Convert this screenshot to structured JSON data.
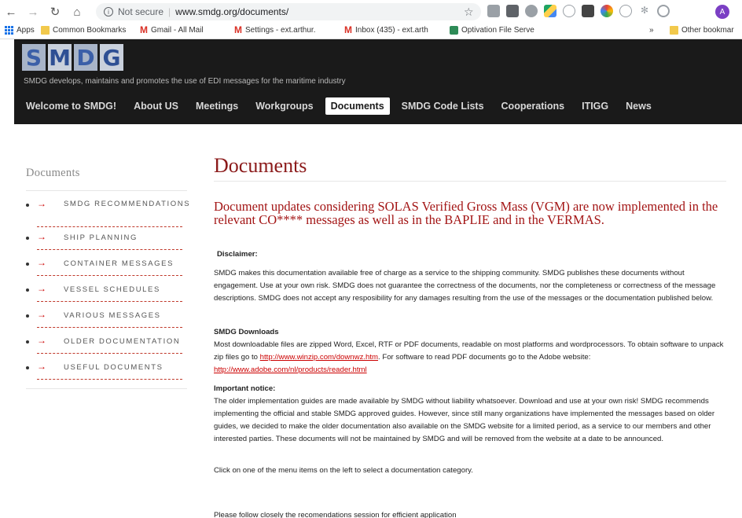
{
  "browser": {
    "not_secure": "Not secure",
    "url": "www.smdg.org/documents/",
    "avatar_letter": "A",
    "bookmarks": {
      "apps": "Apps",
      "common": "Common Bookmarks",
      "gmail": "Gmail - All Mail",
      "settings": "Settings - ext.arthur.",
      "inbox": "Inbox (435) - ext.arth",
      "optivation": "Optivation File Serve",
      "more": "»",
      "other": "Other bookmar"
    }
  },
  "header": {
    "logo_letters": [
      "S",
      "M",
      "D",
      "G"
    ],
    "tagline": "SMDG develops, maintains and promotes the use of EDI messages for the maritime industry",
    "nav": [
      "Welcome to SMDG!",
      "About US",
      "Meetings",
      "Workgroups",
      "Documents",
      "SMDG Code Lists",
      "Cooperations",
      "ITIGG",
      "News"
    ],
    "active_nav": "Documents"
  },
  "sidebar": {
    "title": "Documents",
    "items": [
      {
        "label": "SMDG RECOMMENDATIONS"
      },
      {
        "label": "SHIP PLANNING"
      },
      {
        "label": "CONTAINER MESSAGES"
      },
      {
        "label": "VESSEL SCHEDULES"
      },
      {
        "label": "VARIOUS MESSAGES"
      },
      {
        "label": "OLDER DOCUMENTATION"
      },
      {
        "label": "USEFUL DOCUMENTS"
      }
    ]
  },
  "main": {
    "title": "Documents",
    "headline": "Document updates considering SOLAS Verified Gross Mass (VGM) are now implemented in the relevant CO**** messages as well as in the BAPLIE and in the VERMAS.",
    "disclaimer_heading": "Disclaimer:",
    "disclaimer_text": "SMDG makes this documentation available free of charge as a service to the shipping community. SMDG publishes these documents without engagement. Use at your own risk. SMDG does not guarantee the correctness of the documents, nor the completeness or correctness of the message descriptions. SMDG does not accept any resposibility for any damages resulting from the use of the messages or the documentation published below.",
    "downloads_heading": "SMDG Downloads",
    "downloads_text_1": "Most downloadable files are zipped Word, Excel, RTF or PDF documents, readable on most platforms and wordprocessors. To obtain software to unpack zip files go to ",
    "downloads_link_1": "http://www.winzip.com/downwz.htm",
    "downloads_text_2": ". For software to read PDF documents go to the Adobe website: ",
    "downloads_link_2": "http://www.adobe.com/nl/products/reader.html",
    "notice_heading": "Important notice:",
    "notice_text": "The older implementation guides are made available by SMDG without liability whatsoever. Download and use at your own risk! SMDG recommends implementing the official and stable SMDG approved guides. However, since still many organizations have implemented the messages based on older guides, we decided to make the older documentation also available on the SMDG website for a limited period, as a service to our members and other interested parties. These documents will not be maintained by SMDG and will be removed from the website at a date to be announced.",
    "click_text": "Click on one of the menu items on the left to select a documentation category.",
    "follow_text": "Please follow closely the recomendations session for efficient application"
  }
}
